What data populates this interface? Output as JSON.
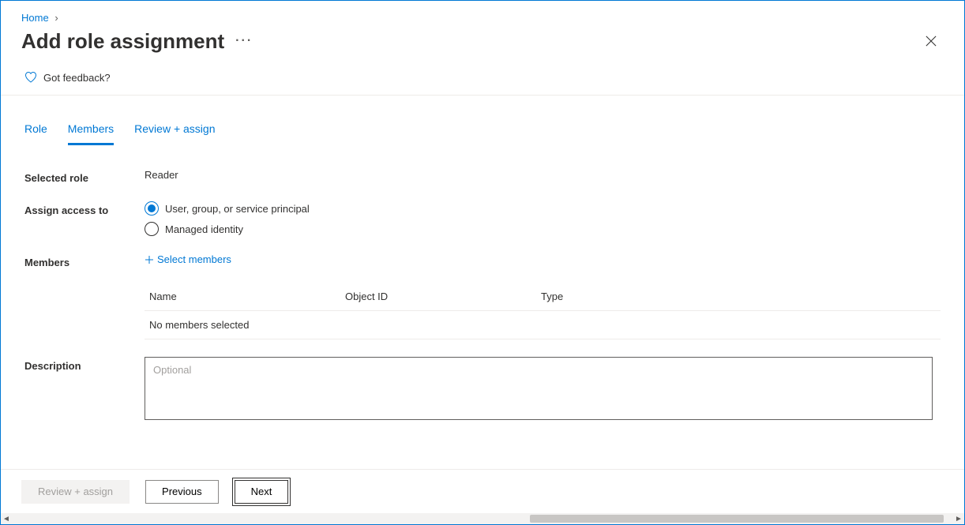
{
  "breadcrumb": {
    "home": "Home"
  },
  "header": {
    "title": "Add role assignment"
  },
  "feedback": {
    "label": "Got feedback?"
  },
  "tabs": {
    "role": "Role",
    "members": "Members",
    "review": "Review + assign"
  },
  "form": {
    "selected_role_label": "Selected role",
    "selected_role_value": "Reader",
    "assign_access_label": "Assign access to",
    "radio_user": "User, group, or service principal",
    "radio_mi": "Managed identity",
    "members_label": "Members",
    "select_members_link": "Select members",
    "members_table": {
      "col_name": "Name",
      "col_objid": "Object ID",
      "col_type": "Type",
      "empty": "No members selected"
    },
    "description_label": "Description",
    "description_placeholder": "Optional"
  },
  "footer": {
    "review": "Review + assign",
    "previous": "Previous",
    "next": "Next"
  }
}
